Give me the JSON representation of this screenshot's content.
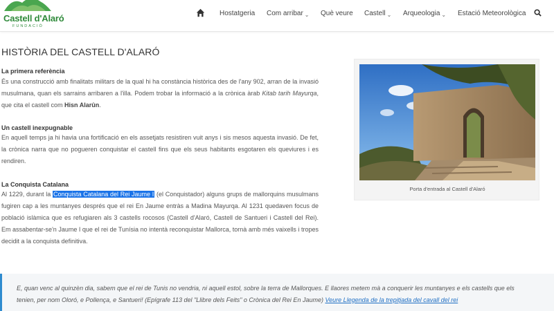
{
  "logo": {
    "title": "Castell d'Alaró",
    "subtitle": "FUNDACIÓ",
    "color": "#2f8a3a"
  },
  "nav": {
    "home_icon": "home-icon",
    "items": [
      {
        "label": "Hostatgeria",
        "dropdown": false
      },
      {
        "label": "Com arribar",
        "dropdown": true
      },
      {
        "label": "Què veure",
        "dropdown": false
      },
      {
        "label": "Castell",
        "dropdown": true
      },
      {
        "label": "Arqueologia",
        "dropdown": true
      },
      {
        "label": "Estació Meteorològica",
        "dropdown": false
      }
    ],
    "chevron": "⌄",
    "search_icon": "search-icon"
  },
  "article": {
    "title": "HISTÒRIA DEL CASTELL D'ALARÓ",
    "sections": [
      {
        "heading": "La primera referència",
        "text_1": "És una construcció amb finalitats militars de la qual hi ha constància històrica des de l'any 902, arran de la invasió musulmana, quan els sarrains arribaren a l'illa. Podem trobar la informació a la crònica àrab ",
        "text_italic": "Kitab tarih Mayurqa",
        "text_2": ", que cita el castell com ",
        "text_bold": "Hisn Alarûn",
        "text_3": "."
      },
      {
        "heading": "Un castell inexpugnable",
        "text": "En aquell temps ja hi havia una fortificació en els assetjats resistiren vuit anys i sis mesos aquesta invasió. De fet, la crònica narra que no pogueren conquistar el castell fins que els seus habitants esgotaren els queviures i es rendiren."
      },
      {
        "heading": "La Conquista Catalana",
        "text_1": "Al 1229, durant la ",
        "link_selected": "Conquista Catalana del Rei Jaume I",
        "text_2": " (el Conquistador) alguns grups de mallorquins musulmans fugiren cap a les muntanyes després que el rei En Jaume entràs a Madina Mayurqa. Al 1231 quedaven focus de població islàmica que es refugiaren als 3 castells rocosos (Castell d'Alaró, Castell de Santueri i Castell del Rei). Em assabentar-se'n Jaume I que el rei de Tunísia no intentà reconquistar Mallorca, tornà amb més vaixells i tropes decidit a la conquista definitiva."
      }
    ],
    "figure_caption": "Porta d'entrada al Castell d'Alaró"
  },
  "quote": {
    "text": "E, quan venc al quinzèn dia, sabem que el rei de Tunis no vendria, ni aquell estol, sobre la terra de Mallorques. E llaores metem mà a conquerir les muntanyes e els castells que els tenien, per nom Oloró, e Pollença, e Santueri! (Epígrafe 113 del \"Llibre dels Feits\" o Crònica del Rei En Jaume) ",
    "link": "Veure Llegenda de la trepitjada del cavall del rei",
    "accent_color": "#2e8bcf"
  },
  "colors": {
    "selection": "#1a73e8",
    "link": "#1f6fc4"
  }
}
